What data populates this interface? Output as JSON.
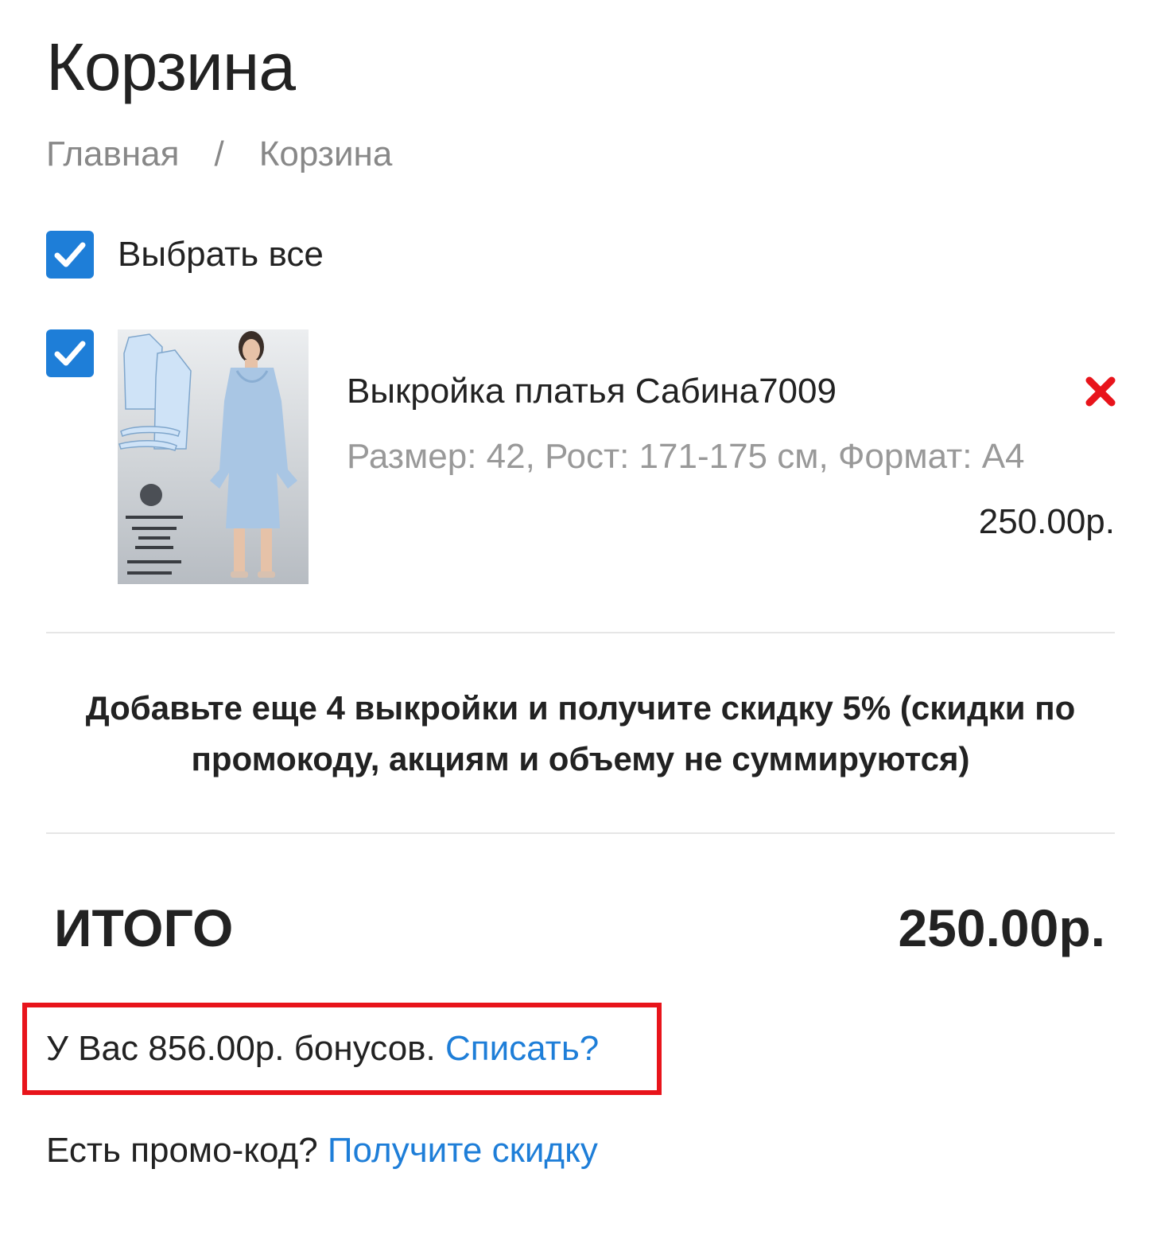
{
  "page": {
    "title": "Корзина"
  },
  "breadcrumb": {
    "home": "Главная",
    "separator": "/",
    "current": "Корзина"
  },
  "select_all": {
    "label": "Выбрать все",
    "checked": true
  },
  "cart_item": {
    "checked": true,
    "name": "Выкройка платья Сабина7009",
    "options": "Размер: 42, Рост: 171-175 см, Формат: А4",
    "price": "250.00р.",
    "remove_icon": "close-icon"
  },
  "discount_notice": {
    "line1": "Добавьте еще 4 выкройки и получите скидку 5% (скидки по",
    "line2": "промокоду, акциям и объему не суммируются)"
  },
  "total": {
    "label": "ИТОГО",
    "value": "250.00р."
  },
  "bonus": {
    "text": "У Вас 856.00р. бонусов.",
    "link": "Списать?"
  },
  "promo": {
    "text": "Есть промо-код?",
    "link": "Получите скидку"
  },
  "colors": {
    "accent": "#1e7ed8",
    "highlight_border": "#e8141b",
    "remove": "#e8141b",
    "muted_text": "#999999",
    "text": "#222222"
  }
}
